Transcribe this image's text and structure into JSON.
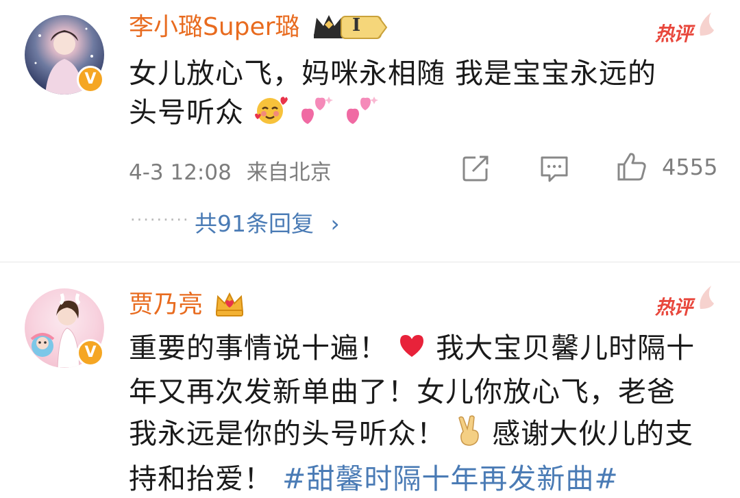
{
  "comments": [
    {
      "username": "李小璐Super璐",
      "rank_badge": "I",
      "hot_label": "热评",
      "text_line1": "女儿放心飞，妈咪永相随 我是宝宝永远的",
      "text_line2": "头号听众",
      "time": "4-3 12:08",
      "location": "来自北京",
      "likes": "4555",
      "replies": "共91条回复",
      "icons": [
        "share-icon",
        "comment-icon",
        "like-icon",
        "crown-icon",
        "verified-icon"
      ]
    },
    {
      "username": "贾乃亮",
      "hot_label": "热评",
      "text_line1": "重要的事情说十遍！",
      "text_line1b": "我大宝贝馨儿时隔十",
      "text_line2": "年又再次发新单曲了！女儿你放心飞，老爸",
      "text_line3": "我永远是你的头号听众！",
      "text_line3b": "感谢大伙儿的支",
      "text_line4": "持和抬爱！",
      "hashtag": "#甜馨时隔十年再发新曲#",
      "icons": [
        "heart-icon",
        "victory-hand-icon",
        "crown-icon",
        "verified-icon"
      ]
    }
  ],
  "colors": {
    "username": "#e86b1f",
    "hot": "#e8473c",
    "link": "#4a7bb5",
    "meta": "#7d7d7d"
  }
}
